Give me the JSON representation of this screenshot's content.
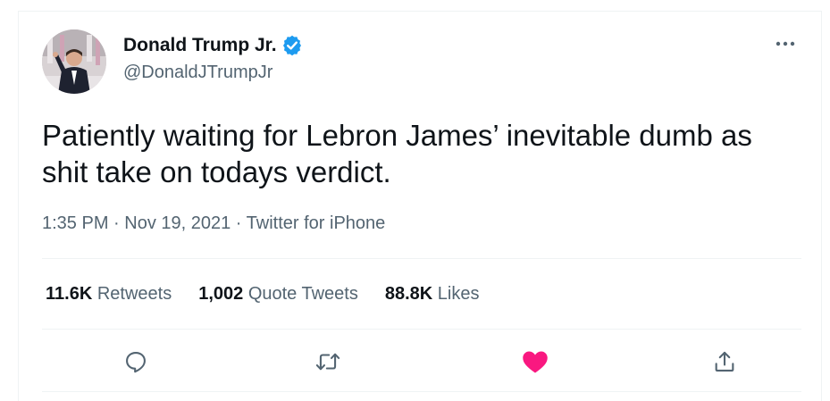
{
  "author": {
    "display_name": "Donald Trump Jr.",
    "handle": "@DonaldJTrumpJr",
    "verified": true
  },
  "tweet": {
    "text": "Patiently waiting for Lebron James’ inevitable dumb as shit take on todays verdict.",
    "time": "1:35 PM",
    "separator": " · ",
    "date": "Nov 19, 2021",
    "source": "Twitter for iPhone"
  },
  "stats": {
    "retweets_count": "11.6K",
    "retweets_label": " Retweets",
    "quote_count": "1,002",
    "quote_label": " Quote Tweets",
    "likes_count": "88.8K",
    "likes_label": " Likes"
  },
  "actions": {
    "reply_icon": "reply-icon",
    "retweet_icon": "retweet-icon",
    "like_icon": "heart-icon",
    "share_icon": "share-icon",
    "liked": true
  },
  "colors": {
    "verified_blue": "#1d9bf0",
    "like_pink": "#f91880",
    "secondary_text": "#536471",
    "primary_text": "#0f1419"
  }
}
